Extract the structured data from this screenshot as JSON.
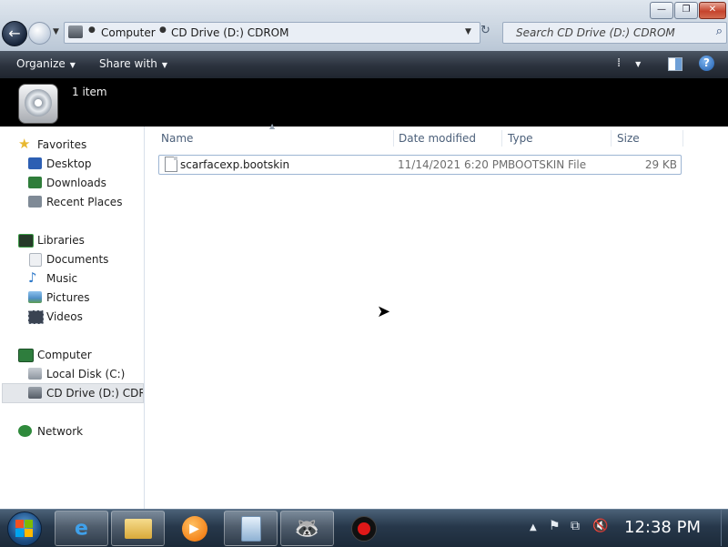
{
  "window": {
    "controls": {
      "minimize": "—",
      "maximize": "❐",
      "close": "✕"
    }
  },
  "address_bar": {
    "crumbs": [
      "Computer",
      "CD Drive (D:) CDROM"
    ],
    "refresh_glyph": "↻"
  },
  "search": {
    "placeholder": "Search CD Drive (D:) CDROM"
  },
  "command_bar": {
    "organize": "Organize",
    "share_with": "Share with"
  },
  "details_pane": {
    "item_count": "1 item"
  },
  "nav_pane": {
    "items": [
      {
        "label": "Favorites",
        "icon": "star-icon",
        "color": "#e8b830"
      },
      {
        "label": "Desktop",
        "icon": "desktop-icon",
        "color": "#2d5fb3"
      },
      {
        "label": "Downloads",
        "icon": "downloads-icon",
        "color": "#2f7d3a"
      },
      {
        "label": "Recent Places",
        "icon": "recent-places-icon",
        "color": "#7f8a96"
      },
      {
        "label": "Libraries",
        "icon": "libraries-icon",
        "color": "#3c9b46"
      },
      {
        "label": "Documents",
        "icon": "documents-icon",
        "color": "#c7ccd3"
      },
      {
        "label": "Music",
        "icon": "music-icon",
        "color": "#2e79c9"
      },
      {
        "label": "Pictures",
        "icon": "pictures-icon",
        "color": "#4f8fc6"
      },
      {
        "label": "Videos",
        "icon": "videos-icon",
        "color": "#3a4352"
      },
      {
        "label": "Computer",
        "icon": "computer-icon",
        "color": "#2e7d3d"
      },
      {
        "label": "Local Disk (C:)",
        "icon": "local-disk-icon",
        "color": "#8d959f"
      },
      {
        "label": "CD Drive (D:) CDROM",
        "icon": "cd-drive-icon",
        "color": "#6c737d"
      },
      {
        "label": "Network",
        "icon": "network-icon",
        "color": "#2f8a3c"
      }
    ]
  },
  "file_list": {
    "columns": [
      "Name",
      "Date modified",
      "Type",
      "Size"
    ],
    "rows": [
      {
        "name": "scarfacexp.bootskin",
        "date": "11/14/2021 6:20 PM",
        "type": "BOOTSKIN File",
        "size": "29 KB"
      }
    ]
  },
  "taskbar": {
    "clock": "12:38 PM",
    "buttons": [
      "internet-explorer-icon",
      "windows-explorer-icon",
      "media-player-icon",
      "recycle-bin-icon",
      "raccoon-app-icon",
      "record-icon"
    ]
  },
  "colors": {
    "command_bar": "#2b323d",
    "selection_border": "#9db5d3",
    "taskbar": "#27384b"
  }
}
